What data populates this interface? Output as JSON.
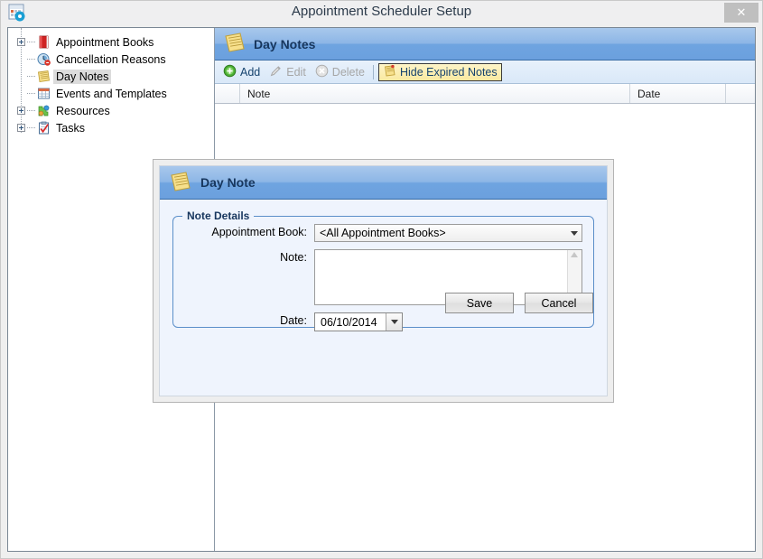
{
  "window": {
    "title": "Appointment Scheduler Setup",
    "icon": "scheduler-setup-icon",
    "close_label": "✕"
  },
  "tree": {
    "items": [
      {
        "label": "Appointment Books",
        "icon": "red-book-icon",
        "expandable": true,
        "selected": false
      },
      {
        "label": "Cancellation Reasons",
        "icon": "clock-cancel-icon",
        "expandable": false,
        "selected": false
      },
      {
        "label": "Day Notes",
        "icon": "yellow-note-icon",
        "expandable": false,
        "selected": true
      },
      {
        "label": "Events and Templates",
        "icon": "calendar-grid-icon",
        "expandable": false,
        "selected": false
      },
      {
        "label": "Resources",
        "icon": "puzzle-people-icon",
        "expandable": true,
        "selected": false
      },
      {
        "label": "Tasks",
        "icon": "checklist-clipboard-icon",
        "expandable": true,
        "selected": false
      }
    ]
  },
  "panel": {
    "caption": "Day Notes",
    "caption_icon": "yellow-note-icon",
    "toolbar": [
      {
        "label": "Add",
        "icon": "green-plus-icon",
        "state": "enabled"
      },
      {
        "label": "Edit",
        "icon": "pencil-icon",
        "state": "disabled"
      },
      {
        "label": "Delete",
        "icon": "gray-x-circle-icon",
        "state": "disabled"
      },
      {
        "label": "Hide Expired Notes",
        "icon": "yellow-note-pin-icon",
        "state": "checked"
      }
    ],
    "grid": {
      "columns": [
        "",
        "Note",
        "Date",
        ""
      ],
      "rows": []
    }
  },
  "dialog": {
    "caption": "Day Note",
    "caption_icon": "yellow-note-icon",
    "group_legend": "Note Details",
    "fields": {
      "appointment_book_label": "Appointment Book:",
      "appointment_book_value": "<All Appointment Books>",
      "appointment_book_options": [
        "<All Appointment Books>"
      ],
      "note_label": "Note:",
      "note_value": "",
      "note_placeholder": "",
      "date_label": "Date:",
      "date_value": "06/10/2014"
    },
    "buttons": {
      "save": "Save",
      "cancel": "Cancel"
    }
  },
  "colors": {
    "caption_gradient_top": "#a8c8ec",
    "caption_gradient_bottom": "#6ba0de",
    "caption_text": "#17365d",
    "toolbar_link": "#16436e",
    "checked_button": "#fae9a0",
    "dialog_bg": "#eff4fd",
    "group_border": "#5b8fc9"
  }
}
